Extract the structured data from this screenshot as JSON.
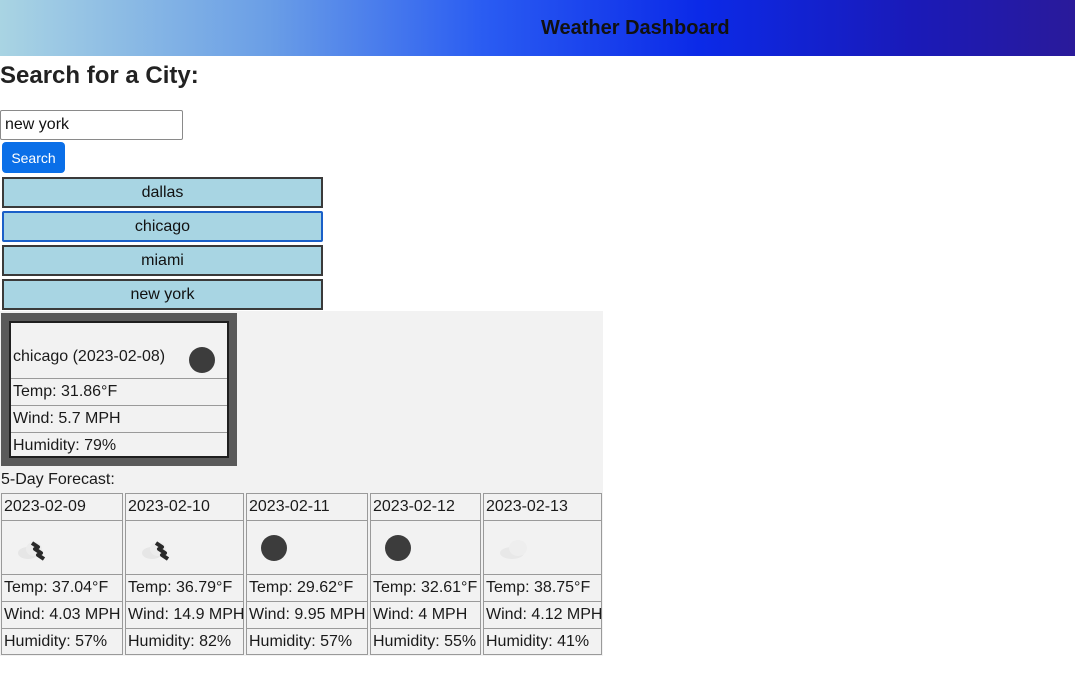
{
  "header": {
    "title": "Weather Dashboard"
  },
  "search": {
    "heading": "Search for a City:",
    "input_value": "new york",
    "button_label": "Search"
  },
  "history": [
    "dallas",
    "chicago",
    "miami",
    "new york"
  ],
  "today": {
    "heading": "chicago (2023-02-08)",
    "icon": "clear-sky-icon",
    "temp": "Temp: 31.86°F",
    "wind": "Wind: 5.7 MPH",
    "humidity": "Humidity: 79%"
  },
  "forecast_label": "5-Day Forecast:",
  "forecast": [
    {
      "date": "2023-02-09",
      "icon": "scattered-clouds-icon",
      "temp": "Temp: 37.04°F",
      "wind": "Wind: 4.03 MPH",
      "humidity": "Humidity: 57%"
    },
    {
      "date": "2023-02-10",
      "icon": "scattered-clouds-icon",
      "temp": "Temp: 36.79°F",
      "wind": "Wind: 14.9 MPH",
      "humidity": "Humidity: 82%"
    },
    {
      "date": "2023-02-11",
      "icon": "clear-sky-icon",
      "temp": "Temp: 29.62°F",
      "wind": "Wind: 9.95 MPH",
      "humidity": "Humidity: 57%"
    },
    {
      "date": "2023-02-12",
      "icon": "clear-sky-icon",
      "temp": "Temp: 32.61°F",
      "wind": "Wind: 4 MPH",
      "humidity": "Humidity: 55%"
    },
    {
      "date": "2023-02-13",
      "icon": "overcast-clouds-icon",
      "temp": "Temp: 38.75°F",
      "wind": "Wind: 4.12 MPH",
      "humidity": "Humidity: 41%"
    }
  ],
  "colors": {
    "search_button": "#0a6fe8",
    "history_button": "#a8d5e3",
    "results_background": "#f2f2f2"
  }
}
